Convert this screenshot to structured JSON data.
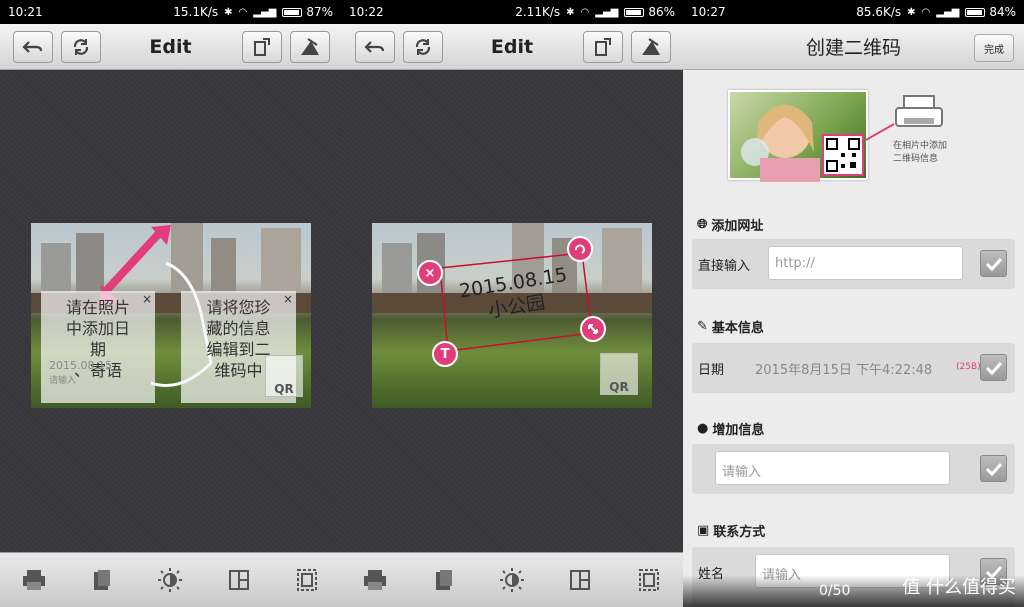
{
  "panels": [
    {
      "status": {
        "time": "10:21",
        "speed": "15.1K/s",
        "battery": "87%"
      },
      "toolbar": {
        "title": "Edit"
      },
      "photo": {
        "tip_left": [
          "请在照片",
          "中添加日",
          "期",
          "、寄语"
        ],
        "tip_right": [
          "请将您珍",
          "藏的信息",
          "编辑到二",
          "维码中"
        ],
        "ghost_date": "2015.08.15",
        "ghost_text": "请输入",
        "qr_label": "QR",
        "close_glyph": "×"
      }
    },
    {
      "status": {
        "time": "10:22",
        "speed": "2.11K/s",
        "battery": "86%"
      },
      "toolbar": {
        "title": "Edit"
      },
      "photo": {
        "stamp_date": "2015.08.15",
        "stamp_text": "小公园",
        "qr_label": "QR",
        "handle_delete": "×",
        "handle_text": "T"
      }
    },
    {
      "status": {
        "time": "10:27",
        "speed": "85.6K/s",
        "battery": "84%"
      },
      "toolbar": {
        "title": "创建二维码",
        "done": "完成"
      },
      "header_caption": [
        "在相片中添加",
        "二维码信息"
      ],
      "sections": {
        "url": {
          "title": "添加网址",
          "label": "直接输入",
          "placeholder": "http://"
        },
        "basic": {
          "title": "基本信息",
          "label": "日期",
          "value": "2015年8月15日 下午4:22:48",
          "bytes": "(25B)"
        },
        "extra": {
          "title": "增加信息",
          "placeholder": "请输入"
        },
        "contact": {
          "title": "联系方式",
          "label": "姓名",
          "placeholder": "请输入"
        }
      },
      "counter": "0/50",
      "watermark": "值 什么值得买"
    }
  ],
  "colors": {
    "accent": "#e23d7b",
    "toolbar": "#dcdcdc",
    "canvas": "#3a3a3e"
  }
}
